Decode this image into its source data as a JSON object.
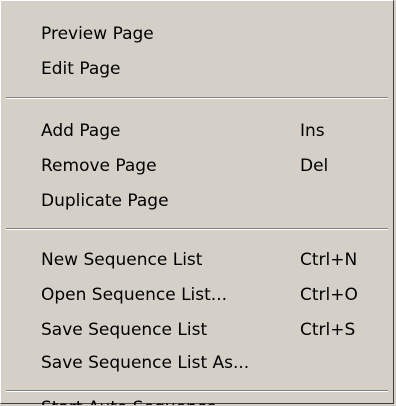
{
  "menu": {
    "items": [
      {
        "label": "Preview Page",
        "shortcut": ""
      },
      {
        "label": "Edit Page",
        "shortcut": ""
      },
      {
        "label": "Add Page",
        "shortcut": "Ins"
      },
      {
        "label": "Remove Page",
        "shortcut": "Del"
      },
      {
        "label": "Duplicate Page",
        "shortcut": ""
      },
      {
        "label": "New Sequence List",
        "shortcut": "Ctrl+N"
      },
      {
        "label": "Open Sequence List...",
        "shortcut": "Ctrl+O"
      },
      {
        "label": "Save Sequence List",
        "shortcut": "Ctrl+S"
      },
      {
        "label": "Save Sequence List As...",
        "shortcut": ""
      },
      {
        "label": "Start Auto Sequence",
        "shortcut": ""
      }
    ]
  }
}
